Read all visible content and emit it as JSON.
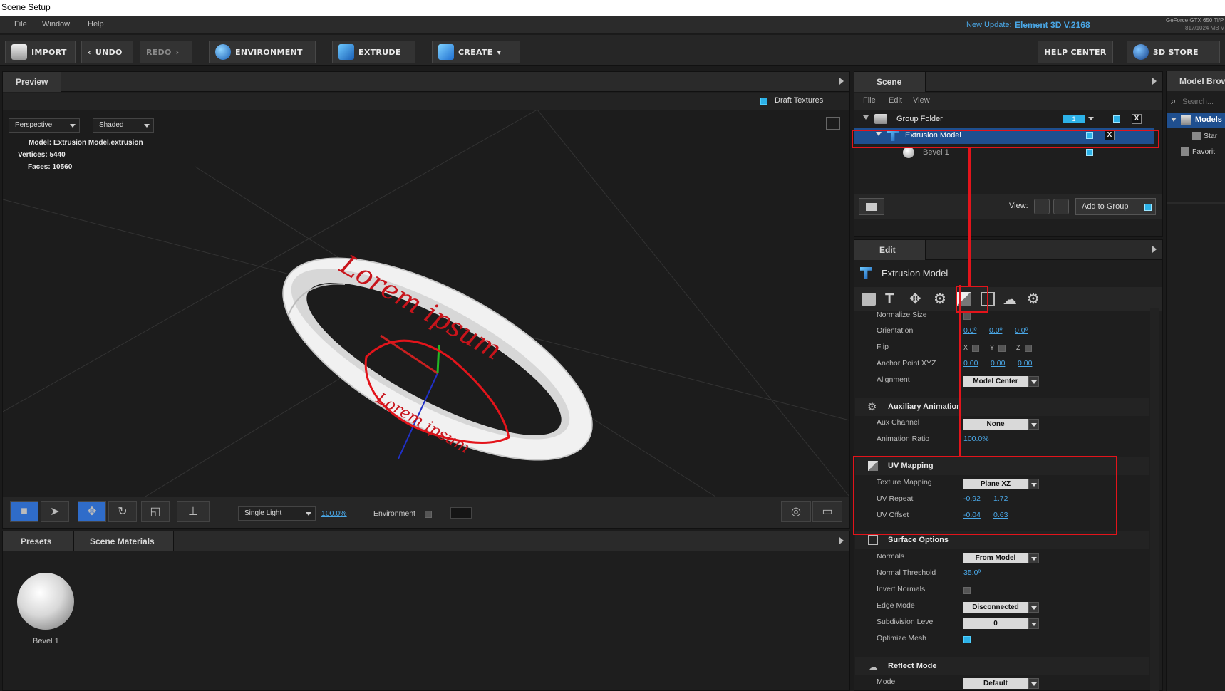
{
  "window": {
    "title": "Scene Setup"
  },
  "menu": [
    "File",
    "Window",
    "Help"
  ],
  "update": {
    "label": "New Update:",
    "version": "Element 3D V.2168"
  },
  "gpu": {
    "name": "GeForce GTX 650 Ti/P",
    "memory": "817/1024 MB V"
  },
  "toolbar": {
    "import": "IMPORT",
    "undo": "UNDO",
    "redo": "REDO",
    "environment": "ENVIRONMENT",
    "extrude": "EXTRUDE",
    "create": "CREATE",
    "help_center": "HELP CENTER",
    "store": "3D STORE"
  },
  "preview": {
    "tab": "Preview",
    "draft_textures": "Draft Textures",
    "camera_mode": "Perspective",
    "shading": "Shaded",
    "info": {
      "model_label": "Model:",
      "model": "Extrusion Model.extrusion",
      "vertices_label": "Vertices:",
      "vertices": "5440",
      "faces_label": "Faces:",
      "faces": "10560"
    },
    "ring_text": "Lorem ipsum",
    "lighting": "Single Light",
    "zoom": "100.0%",
    "environment_label": "Environment"
  },
  "materials": {
    "tabs": [
      "Presets",
      "Scene Materials"
    ],
    "items": [
      {
        "name": "Bevel 1"
      }
    ]
  },
  "scene": {
    "tab": "Scene",
    "menu": [
      "File",
      "Edit",
      "View"
    ],
    "items": [
      {
        "name": "Group Folder",
        "badge": "1"
      },
      {
        "name": "Extrusion Model"
      },
      {
        "name": "Bevel 1"
      }
    ],
    "view_label": "View:",
    "add_to_group": "Add to Group"
  },
  "edit": {
    "tab": "Edit",
    "model_name": "Extrusion Model",
    "props": {
      "normalize_size": "Normalize Size",
      "orientation": "Orientation",
      "orientation_vals": [
        "0.0º",
        "0.0º",
        "0.0º"
      ],
      "flip": "Flip",
      "flip_axes": [
        "X",
        "Y",
        "Z"
      ],
      "anchor": "Anchor Point XYZ",
      "anchor_vals": [
        "0.00",
        "0.00",
        "0.00"
      ],
      "alignment": "Alignment",
      "alignment_val": "Model Center"
    },
    "aux": {
      "title": "Auxiliary Animation",
      "channel": "Aux Channel",
      "channel_val": "None",
      "ratio": "Animation Ratio",
      "ratio_val": "100.0%"
    },
    "uv": {
      "title": "UV Mapping",
      "texture_mapping": "Texture Mapping",
      "texture_mapping_val": "Plane XZ",
      "repeat": "UV Repeat",
      "repeat_vals": [
        "-0.92",
        "1.72"
      ],
      "offset": "UV Offset",
      "offset_vals": [
        "-0.04",
        "0.63"
      ]
    },
    "surface": {
      "title": "Surface Options",
      "normals": "Normals",
      "normals_val": "From Model",
      "threshold": "Normal Threshold",
      "threshold_val": "35.0º",
      "invert": "Invert Normals",
      "edge": "Edge Mode",
      "edge_val": "Disconnected",
      "subdiv": "Subdivision Level",
      "subdiv_val": "0",
      "optimize": "Optimize Mesh"
    },
    "reflect": {
      "title": "Reflect Mode",
      "mode": "Mode",
      "mode_val": "Default"
    }
  },
  "browser": {
    "tab": "Model Brow",
    "search_placeholder": "Search...",
    "items": [
      "Models",
      "Star",
      "Favorit"
    ]
  },
  "colors": {
    "accent": "#2db2e8",
    "highlight": "#e3141b",
    "selection": "#1f4f8f"
  }
}
